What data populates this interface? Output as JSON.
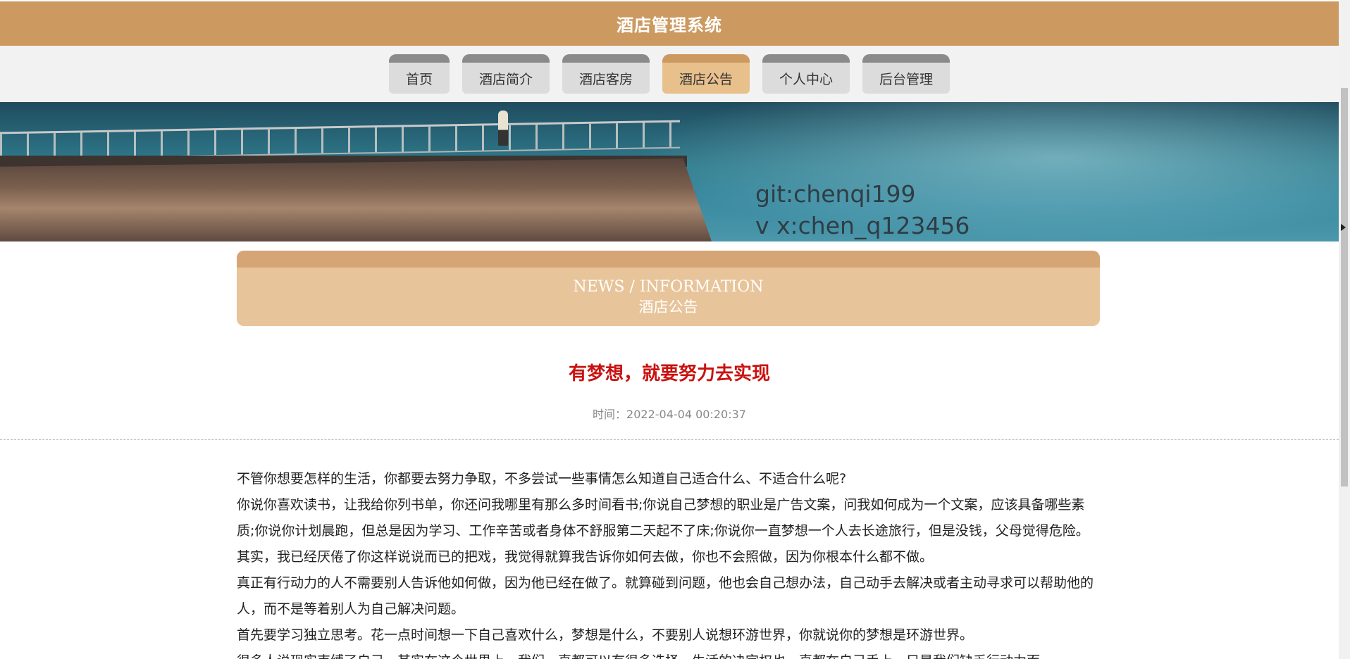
{
  "app": {
    "title": "酒店管理系统"
  },
  "nav": {
    "items": [
      {
        "label": "首页"
      },
      {
        "label": "酒店简介"
      },
      {
        "label": "酒店客房"
      },
      {
        "label": "酒店公告"
      },
      {
        "label": "个人中心"
      },
      {
        "label": "后台管理"
      }
    ],
    "active_index": 3
  },
  "banner": {
    "line1": "git:chenqi199",
    "line2": "v x:chen_q123456"
  },
  "section": {
    "title_en": "NEWS / INFORMATION",
    "title_cn": "酒店公告"
  },
  "article": {
    "title": "有梦想，就要努力去实现",
    "time": "时间：2022-04-04 00:20:37",
    "paragraphs": [
      "不管你想要怎样的生活，你都要去努力争取，不多尝试一些事情怎么知道自己适合什么、不适合什么呢?",
      "你说你喜欢读书，让我给你列书单，你还问我哪里有那么多时间看书;你说自己梦想的职业是广告文案，问我如何成为一个文案，应该具备哪些素质;你说你计划晨跑，但总是因为学习、工作辛苦或者身体不舒服第二天起不了床;你说你一直梦想一个人去长途旅行，但是没钱，父母觉得危险。其实，我已经厌倦了你这样说说而已的把戏，我觉得就算我告诉你如何去做，你也不会照做，因为你根本什么都不做。",
      "真正有行动力的人不需要别人告诉他如何做，因为他已经在做了。就算碰到问题，他也会自己想办法，自己动手去解决或者主动寻求可以帮助他的人，而不是等着别人为自己解决问题。",
      "首先要学习独立思考。花一点时间想一下自己喜欢什么，梦想是什么，不要别人说想环游世界，你就说你的梦想是环游世界。",
      "很多人说现实束缚了自己，其实在这个世界上，我们一直都可以有很多选择，生活的决定权也一直都在自己手上，只是我们缺乏行动力而"
    ]
  },
  "colors": {
    "accent": "#cc9a60",
    "tab_active": "#e8c08c",
    "tab_inactive": "#dcdcdc",
    "title_red": "#c9120f"
  }
}
